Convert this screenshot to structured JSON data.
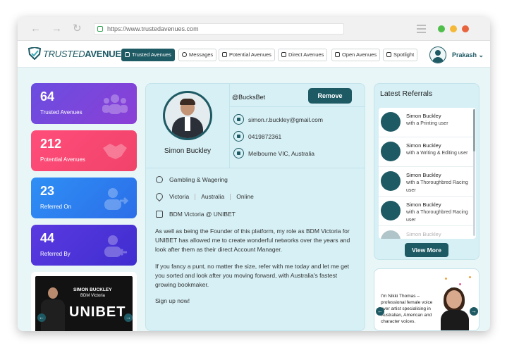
{
  "browser": {
    "url": "https://www.trustedavenues.com",
    "traffic_colors": [
      "#4fbe4a",
      "#f5b93a",
      "#e8643c"
    ]
  },
  "brand": {
    "name_part1": "TRUSTED",
    "name_part2": "AVENUES",
    "trademark": "®",
    "accent": "#1e5a64"
  },
  "nav": {
    "tabs": [
      {
        "label": "Trusted Avenues",
        "active": true
      },
      {
        "label": "Messages"
      },
      {
        "label": "Potential Avenues"
      },
      {
        "label": "Direct Avenues"
      },
      {
        "label": "Open Avenues"
      },
      {
        "label": "Spotlight"
      }
    ],
    "user": {
      "name": "Prakash",
      "caret": "⌄"
    }
  },
  "stats": [
    {
      "value": "64",
      "label": "Trusted Avenues",
      "color_from": "#6a4de0",
      "color_to": "#8b3fd6",
      "icon": "group-icon"
    },
    {
      "value": "212",
      "label": "Potential Avenues",
      "color_from": "#ff4d7a",
      "color_to": "#f0436a",
      "icon": "handshake-icon"
    },
    {
      "value": "23",
      "label": "Referred On",
      "color_from": "#2f8ff5",
      "color_to": "#2b6ee8",
      "icon": "user-arrow-icon"
    },
    {
      "value": "44",
      "label": "Referred By",
      "color_from": "#5a3ae0",
      "color_to": "#3f2dd0",
      "icon": "user-return-icon"
    }
  ],
  "promo": {
    "line1": "SIMON BUCKLEY",
    "line2": "BDM Victoria",
    "brand": "UNIBET",
    "prev": "←",
    "next": "→"
  },
  "profile": {
    "name": "Simon Buckley",
    "handle": "@BucksBet",
    "remove_label": "Remove",
    "email": "simon.r.buckley@gmail.com",
    "phone": "0419872361",
    "location": "Melbourne VIC, Australia",
    "industry": "Gambling & Wagering",
    "areas": [
      "Victoria",
      "Australia",
      "Online"
    ],
    "role": "BDM Victoria @ UNIBET",
    "bio": [
      "As well as being the Founder of this platform, my role as BDM Victoria for UNIBET has allowed me to create wonderful networks over the years and look after them as their direct Account Manager.",
      "If you fancy a punt, no matter the size, refer with me today and let me get you sorted and look after you moving forward, with Australia's fastest growing bookmaker.",
      "Sign up now!"
    ]
  },
  "referrals": {
    "title": "Latest Referrals",
    "items": [
      {
        "name": "Simon Buckley",
        "desc": "with a Printing user"
      },
      {
        "name": "Simon Buckley",
        "desc": "with a Writing & Editing user"
      },
      {
        "name": "Simon Buckley",
        "desc": "with a Thoroughbred Racing user"
      },
      {
        "name": "Simon Buckley",
        "desc": "with a Thoroughbred Racing user"
      },
      {
        "name": "Simon Buckley",
        "desc": ""
      }
    ],
    "view_more": "View More"
  },
  "ad": {
    "text": "I'm Nikki Thomas – professional female voice over artist specialising in Australian, American and character voices.",
    "prev": "←",
    "next": "→"
  }
}
